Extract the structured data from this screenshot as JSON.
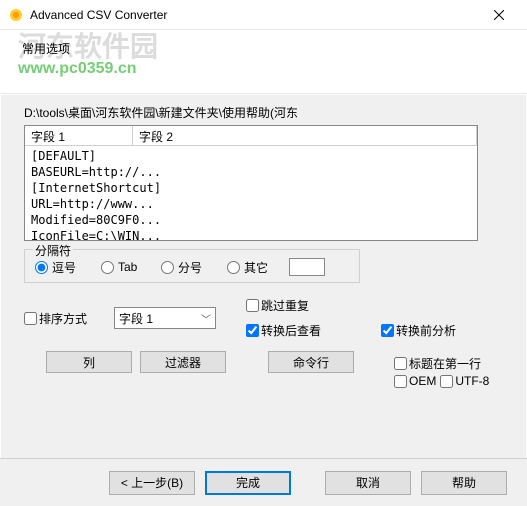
{
  "title": "Advanced CSV Converter",
  "header_label": "常用选项",
  "branding": {
    "line1": "河东软件园",
    "line2": "www.pc0359.cn"
  },
  "path": "D:\\tools\\桌面\\河东软件园\\新建文件夹\\使用帮助(河东",
  "list_headers": [
    "字段 1",
    "字段 2"
  ],
  "list_rows": [
    "[DEFAULT]",
    "BASEURL=http://...",
    "[InternetShortcut]",
    "URL=http://www...",
    "Modified=80C9F0...",
    "IconFile=C:\\WIN..."
  ],
  "separator": {
    "group_title": "分隔符",
    "comma": "逗号",
    "tab": "Tab",
    "semicolon": "分号",
    "other": "其它"
  },
  "checks": {
    "header_first": "标题在第一行",
    "oem": "OEM",
    "utf8": "UTF-8",
    "sort": "排序方式",
    "skip_dup": "跳过重复",
    "view_after": "转换后查看",
    "analyze_before": "转换前分析"
  },
  "combo_value": "字段 1",
  "buttons": {
    "columns": "列",
    "filter": "过滤器",
    "cmdline": "命令行",
    "back": "< 上一步(B)",
    "finish": "完成",
    "cancel": "取消",
    "help": "帮助"
  }
}
